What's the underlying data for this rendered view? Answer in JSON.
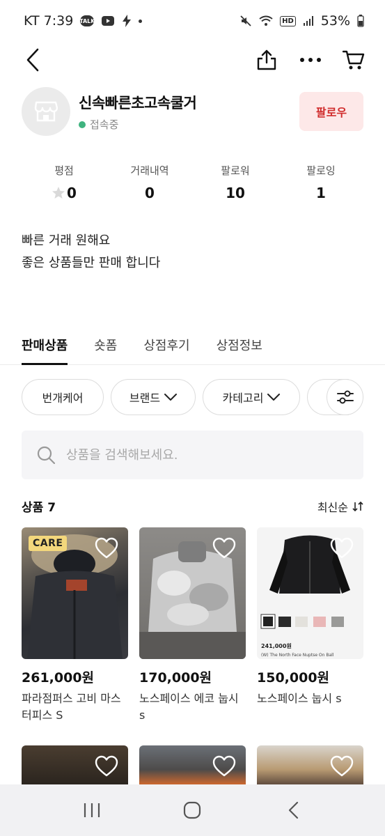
{
  "status_bar": {
    "carrier_time": "KT 7:39",
    "talk_badge": "TALK",
    "hd": "HD",
    "battery": "53%"
  },
  "shop": {
    "name": "신속빠른초고속쿨거",
    "status": "접속중",
    "follow_label": "팔로우"
  },
  "stats": [
    {
      "label": "평점",
      "value": "0"
    },
    {
      "label": "거래내역",
      "value": "0"
    },
    {
      "label": "팔로워",
      "value": "10"
    },
    {
      "label": "팔로잉",
      "value": "1"
    }
  ],
  "description": {
    "line1": "빠른 거래 원해요",
    "line2": "좋은 상품들만 판매 합니다"
  },
  "tabs": [
    {
      "label": "판매상품",
      "active": true
    },
    {
      "label": "숏폼",
      "active": false
    },
    {
      "label": "상점후기",
      "active": false
    },
    {
      "label": "상점정보",
      "active": false
    }
  ],
  "filters": [
    {
      "label": "번개케어"
    },
    {
      "label": "브랜드"
    },
    {
      "label": "카테고리"
    }
  ],
  "search": {
    "placeholder": "상품을 검색해보세요."
  },
  "products_header": {
    "count_label": "상품 7",
    "sort_label": "최신순"
  },
  "products": [
    {
      "price": "261,000원",
      "title": "파라점퍼스 고비 마스터피스 S",
      "badge": "CARE"
    },
    {
      "price": "170,000원",
      "title": "노스페이스 에코 눕시 s"
    },
    {
      "price": "150,000원",
      "title": "노스페이스 눕시 s",
      "image_price": "241,000원",
      "image_caption": "(W) The North Face Nuptse On Ball"
    }
  ],
  "colors": {
    "accent": "#d02c2c",
    "follow_bg": "#fde8e8",
    "online": "#3fb37f",
    "care_badge": "#f3d77c"
  }
}
